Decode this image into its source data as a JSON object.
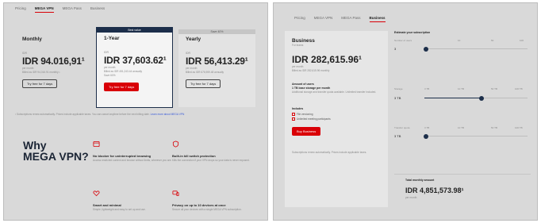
{
  "left": {
    "tabs": [
      "Pricing",
      "MEGA VPN",
      "MEGA Pass",
      "Business"
    ],
    "active_tab_index": 1,
    "plans": [
      {
        "title": "Monthly",
        "small": "IDR",
        "price": "IDR 94.016,91¹",
        "line1": "per month",
        "line2": "Billed as IDR 94,016.91 monthly •",
        "line3": "",
        "button": "Try free for 7 days",
        "button_style": "outline",
        "banner": ""
      },
      {
        "title": "1-Year",
        "small": "IDR",
        "price": "IDR 37,603.62¹",
        "line1": "per month",
        "line2": "Billed as IDR 451,243.44 annually",
        "line3": "Save 60%",
        "button": "Try free for 7 days",
        "button_style": "red",
        "banner": "Best value"
      },
      {
        "title": "Yearly",
        "small": "IDR",
        "price": "IDR 56,413.29¹",
        "line1": "per month",
        "line2": "Billed as IDR 676,959.48 annually",
        "line3": "",
        "button": "Try free for 7 days",
        "button_style": "outline",
        "banner": "Save 40%"
      }
    ],
    "footnote": "¹ Subscriptions renew automatically. Prices include applicable taxes. You can cancel anytime before the next billing date.",
    "footnote_link": "Learn more about MEGA VPN",
    "why_line1": "Why",
    "why_line2": "MEGA VPN?",
    "features": [
      {
        "title": "No blocker for uninterrupted browsing",
        "desc": "Access restricted content and browse without limits, wherever you are.",
        "icon": "browser-icon"
      },
      {
        "title": "Built-in kill switch protection",
        "desc": "Kills the connection if your VPN drops so your data is never exposed.",
        "icon": "shield-icon"
      },
      {
        "title": "Smart and minimal",
        "desc": "Simple, lightweight and easy to set up and use.",
        "icon": "heart-icon"
      },
      {
        "title": "Privacy on up to 10 devices at once",
        "desc": "Secure all your devices with a single MEGA VPN subscription.",
        "icon": "devices-icon"
      }
    ]
  },
  "right": {
    "tabs": [
      "Pricing",
      "MEGA VPN",
      "MEGA Pass",
      "Business"
    ],
    "active_tab_index": 3,
    "business": {
      "title": "Business",
      "subtitle": "For teams",
      "price": "IDR 282,615.96¹",
      "price_sub": "per month",
      "price_note": "Billed as IDR 282,615.96 monthly",
      "storage_label": "Amount of users",
      "storage_value": "1 TB base storage per month",
      "storage_desc": "Additional storage and transfer quota available. Unlimited transfer included.",
      "features_label": "Includes",
      "check1": "File versioning",
      "check2": "Unlimited meeting participants",
      "button": "Buy Business",
      "footnote": "Subscriptions renew automatically. Prices include applicable taxes."
    },
    "slider_head": "Estimate your subscription",
    "sliders": [
      {
        "label": "Number of users",
        "ticks": [
          "3",
          "10",
          "50",
          "100"
        ],
        "value": "3",
        "fill": 0.0
      },
      {
        "label": "Storage",
        "ticks": [
          "3 TB",
          "10 TB",
          "50 TB",
          "100 TB"
        ],
        "value": "3 TB",
        "fill": 0.55
      },
      {
        "label": "Transfer quota",
        "ticks": [
          "3 TB",
          "10 TB",
          "50 TB",
          "100 TB"
        ],
        "value": "3 TB",
        "fill": 0.0
      }
    ],
    "total_label": "Total monthly amount",
    "total_price": "IDR 4,851,573.98¹",
    "total_sub": "per month"
  },
  "colors": {
    "accent_red": "#d90007",
    "navy": "#1c2e4a",
    "panel_bg": "#d9d9d9"
  }
}
